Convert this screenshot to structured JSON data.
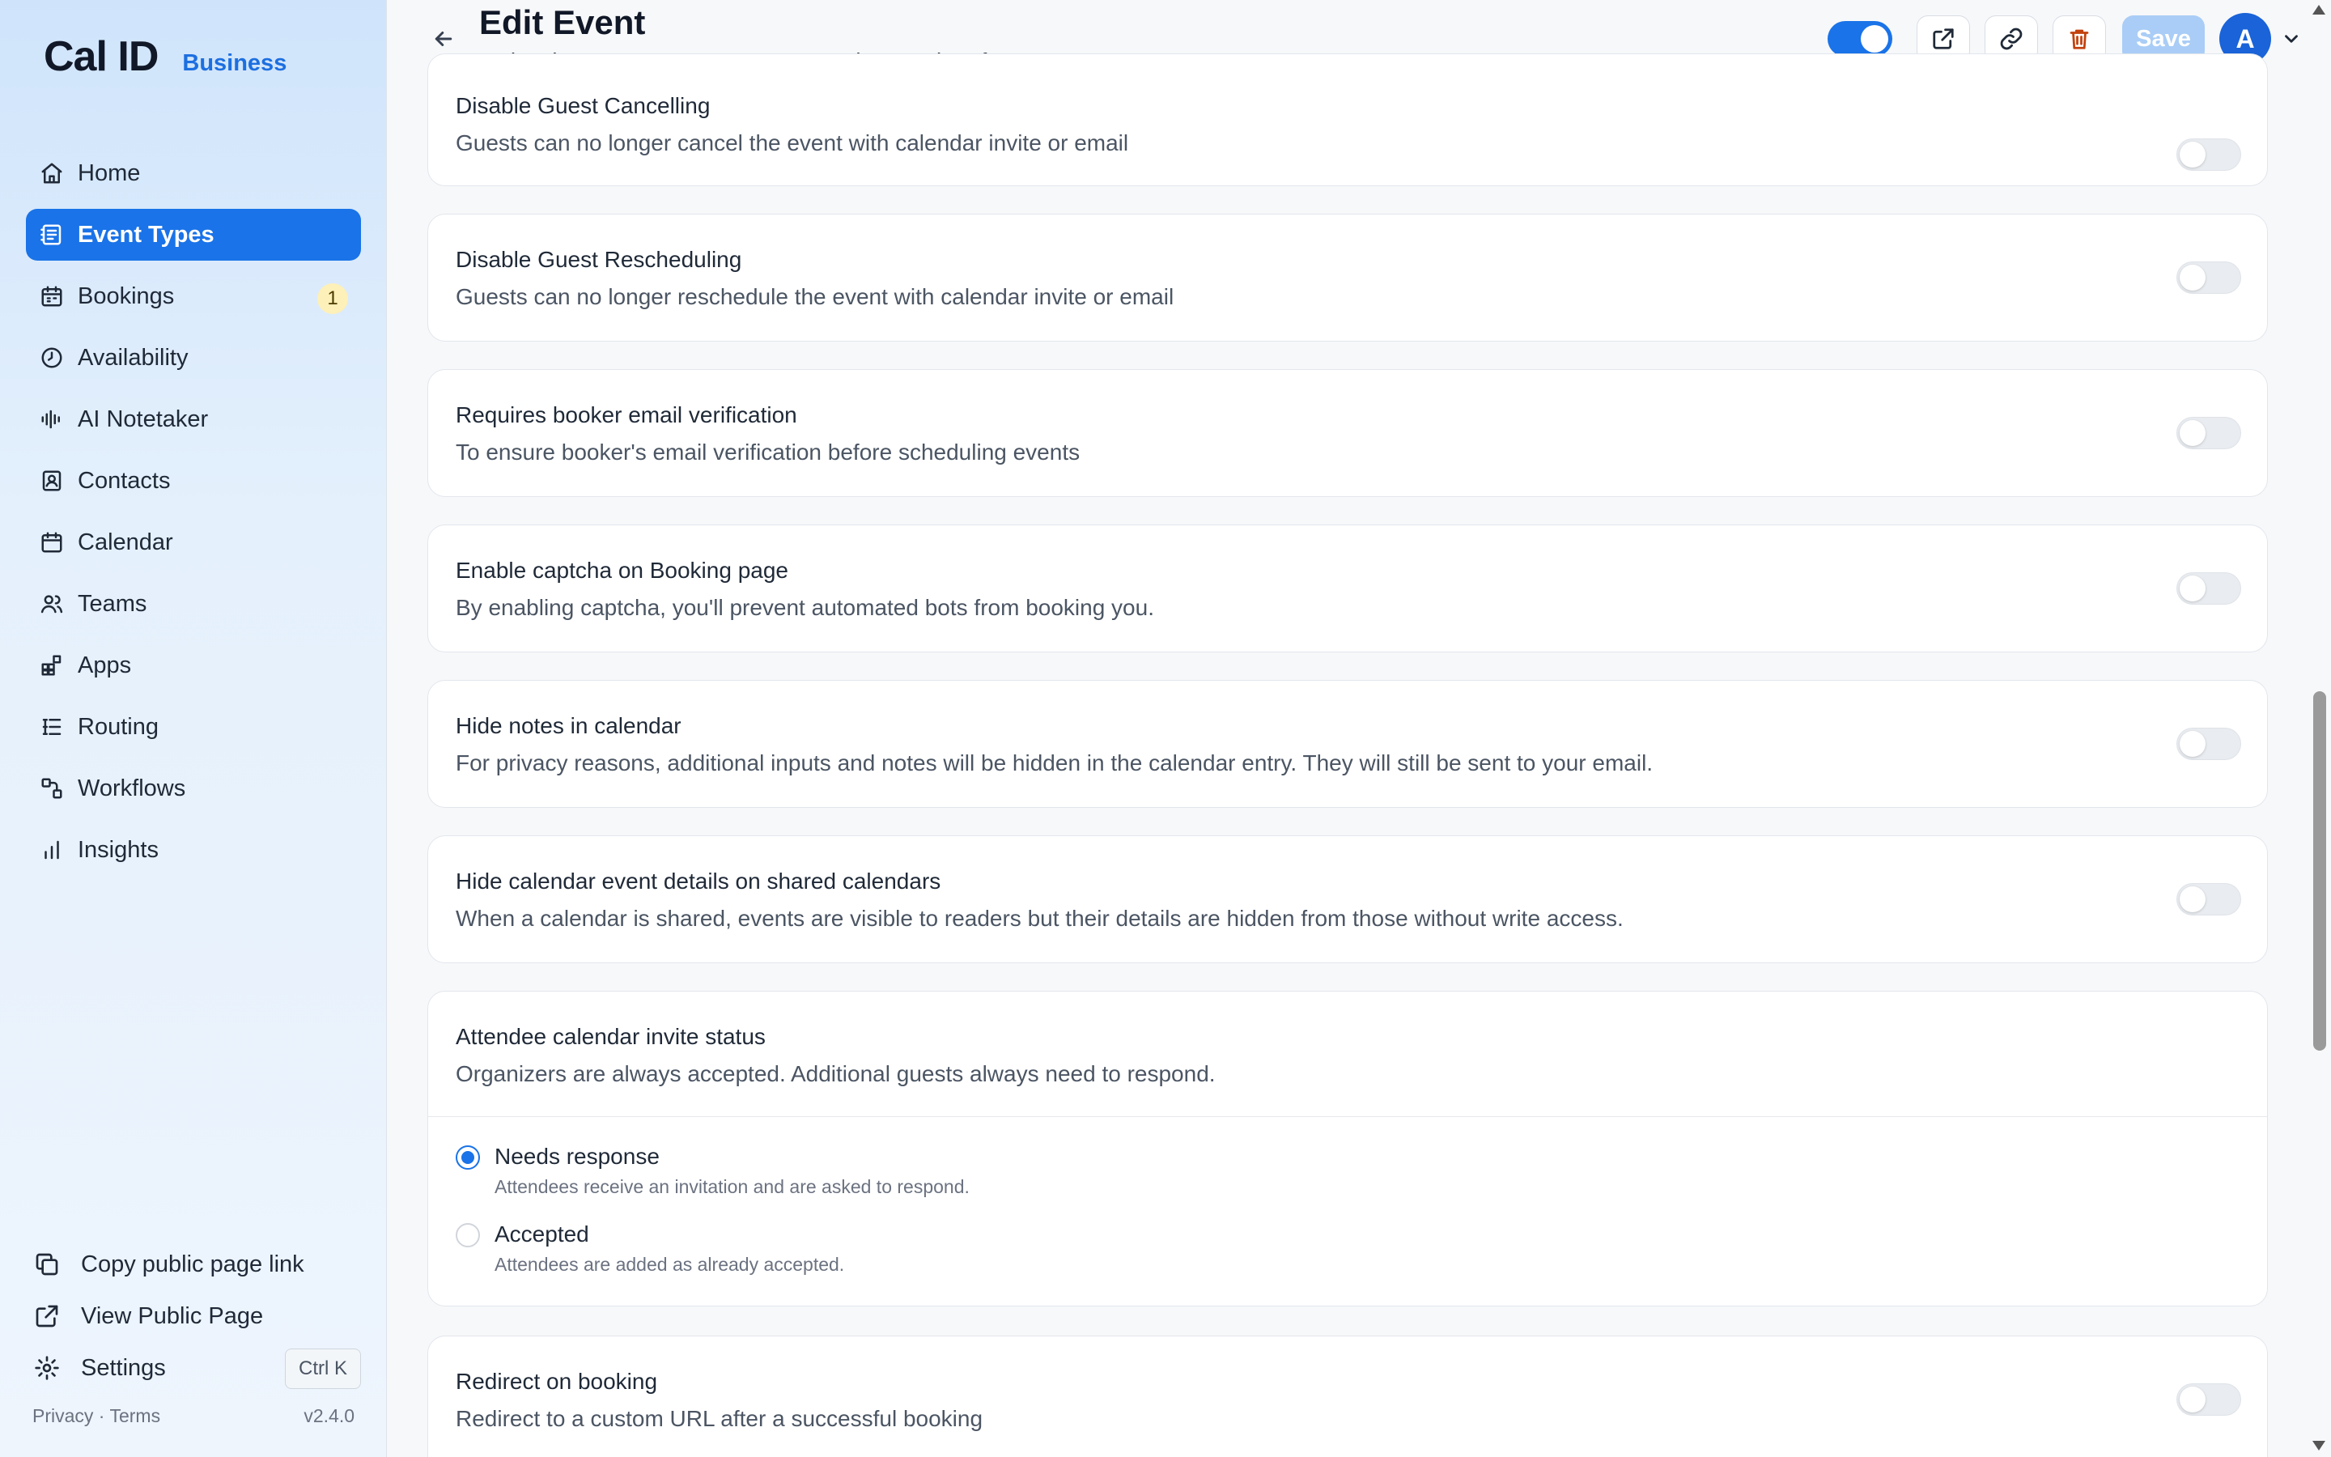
{
  "brand": {
    "name": "Cal ID",
    "plan": "Business"
  },
  "sidebar": {
    "items": [
      {
        "label": "Home",
        "icon": "home-icon"
      },
      {
        "label": "Event Types",
        "icon": "event-types-icon",
        "active": true
      },
      {
        "label": "Bookings",
        "icon": "bookings-calendar-icon",
        "badge": "1"
      },
      {
        "label": "Availability",
        "icon": "clock-icon"
      },
      {
        "label": "AI Notetaker",
        "icon": "waveform-icon"
      },
      {
        "label": "Contacts",
        "icon": "contact-card-icon"
      },
      {
        "label": "Calendar",
        "icon": "calendar-icon"
      },
      {
        "label": "Teams",
        "icon": "users-icon"
      },
      {
        "label": "Apps",
        "icon": "apps-grid-icon"
      },
      {
        "label": "Routing",
        "icon": "routing-list-icon"
      },
      {
        "label": "Workflows",
        "icon": "workflow-icon"
      },
      {
        "label": "Insights",
        "icon": "bar-chart-icon"
      }
    ],
    "bottom": {
      "copy_link": "Copy public page link",
      "view_public": "View Public Page",
      "settings": "Settings",
      "settings_shortcut": "Ctrl K"
    },
    "footer": {
      "privacy": "Privacy",
      "separator": "·",
      "terms": "Terms",
      "version": "v2.4.0"
    }
  },
  "header": {
    "title": "Edit Event",
    "subtitle": "Make changes to your event type settings and preferences",
    "save_label": "Save",
    "avatar_initial": "A",
    "enabled": true
  },
  "settings": [
    {
      "title": "Disable Guest Cancelling",
      "desc": "Guests can no longer cancel the event with calendar invite or email",
      "on": false
    },
    {
      "title": "Disable Guest Rescheduling",
      "desc": "Guests can no longer reschedule the event with calendar invite or email",
      "on": false
    },
    {
      "title": "Requires booker email verification",
      "desc": "To ensure booker's email verification before scheduling events",
      "on": false
    },
    {
      "title": "Enable captcha on Booking page",
      "desc": "By enabling captcha, you'll prevent automated bots from booking you.",
      "on": false
    },
    {
      "title": "Hide notes in calendar",
      "desc": "For privacy reasons, additional inputs and notes will be hidden in the calendar entry. They will still be sent to your email.",
      "on": false
    },
    {
      "title": "Hide calendar event details on shared calendars",
      "desc": "When a calendar is shared, events are visible to readers but their details are hidden from those without write access.",
      "on": false
    }
  ],
  "invite_status": {
    "title": "Attendee calendar invite status",
    "desc": "Organizers are always accepted. Additional guests always need to respond.",
    "options": [
      {
        "label": "Needs response",
        "hint": "Attendees receive an invitation and are asked to respond.",
        "selected": true
      },
      {
        "label": "Accepted",
        "hint": "Attendees are added as already accepted.",
        "selected": false
      }
    ]
  },
  "redirect": {
    "title": "Redirect on booking",
    "desc": "Redirect to a custom URL after a successful booking",
    "on": false
  },
  "colors": {
    "accent": "#1a73e8",
    "save_disabled": "#a9cdf6",
    "badge": "#fdf0b8",
    "trash": "#c2410c"
  }
}
